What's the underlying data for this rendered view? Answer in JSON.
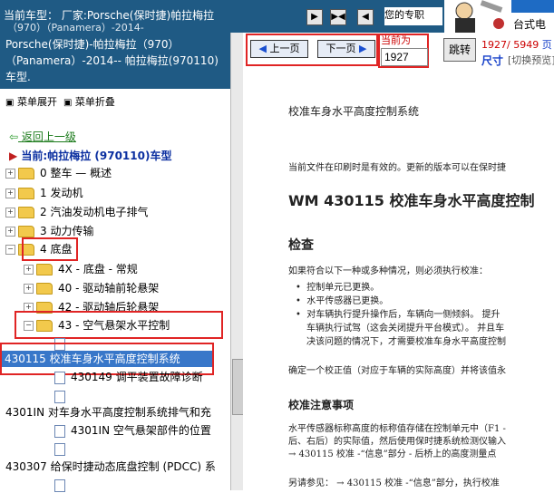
{
  "topbar": {
    "current_model": "当前车型：  厂家:Porsche(保时捷)帕拉梅拉",
    "current_model_cont": "（970）（Panamera）-2014-",
    "user_text": "您的专职",
    "brand_text": "台式电",
    "nav_buttons": [
      "▶",
      "▶◀",
      "◀"
    ]
  },
  "left": {
    "model_title": "Porsche(保时捷)-帕拉梅拉（970）（Panamera）-2014-- 帕拉梅拉(970110)车型.",
    "expand_label": "菜单展开",
    "collapse_label": "菜单折叠",
    "back_label": "返回上一级",
    "current_label": "当前:帕拉梅拉 (970110)车型",
    "tree": [
      {
        "label": "0 整车 — 概述"
      },
      {
        "label": "1 发动机"
      },
      {
        "label": "2 汽油发动机电子排气"
      },
      {
        "label": "3 动力传输"
      },
      {
        "label": "4 底盘"
      },
      {
        "label": "4X - 底盘 - 常规"
      },
      {
        "label": "40 - 驱动轴前轮悬架"
      },
      {
        "label": "42 - 驱动轴后轮悬架"
      },
      {
        "label": "43 - 空气悬架水平控制"
      }
    ],
    "selected_item": "430115 校准车身水平高度控制系统",
    "doc_items": [
      {
        "label": "430149 调平装置故障诊断"
      },
      {
        "label": "4301IN 对车身水平高度控制系统排气和充"
      },
      {
        "label": "4301IN 空气悬架部件的位置"
      },
      {
        "label": "430307 给保时捷动态底盘控制 (PDCC) 系"
      }
    ]
  },
  "right": {
    "prev_label": "上一页",
    "next_label": "下一页",
    "current_page_label": "当前为",
    "page_input_value": "1927",
    "jump_label": "跳转",
    "page_count": "1927/ 5949",
    "page_unit": "页",
    "size_label": "尺寸",
    "switch_label": "[切换预览]",
    "doc": {
      "heading": "校准车身水平高度控制系统",
      "note": "当前文件在印刷时是有效的。更新的版本可以在保时捷",
      "title": "WM 430115 校准车身水平高度控制",
      "section1": "检查",
      "p1": "如果符合以下一种或多种情况，则必须执行校准：",
      "bullets": [
        "控制单元已更换。",
        "水平传感器已更换。",
        "对车辆执行提升操作后，车辆向一侧倾斜。  提升",
        "车辆执行试驾（这会关闭提升平台模式）。 并且车",
        "决该问题的情况下，才需要校准车身水平高度控制"
      ],
      "p2": "确定一个校正值（对应于车辆的实际高度）并将该值永",
      "section2": "校准注意事项",
      "p3": "水平传感器标称高度的标称值存储在控制单元中（F1 -",
      "p3b": "后、右后）的实际值，然后使用保时捷系统检测仪输入",
      "p3c": "→ 430115 校准 -“信息”部分 - 后桥上的高度测量点",
      "p4": "另请参见：  → 430115 校准 -“信息”部分，执行校准"
    }
  },
  "colors": {
    "header_blue": "#1f5a84",
    "selection_blue": "#3877c9",
    "highlight_red": "#e02424",
    "link_green": "#1a7a1a",
    "page_red": "#cc0000"
  }
}
